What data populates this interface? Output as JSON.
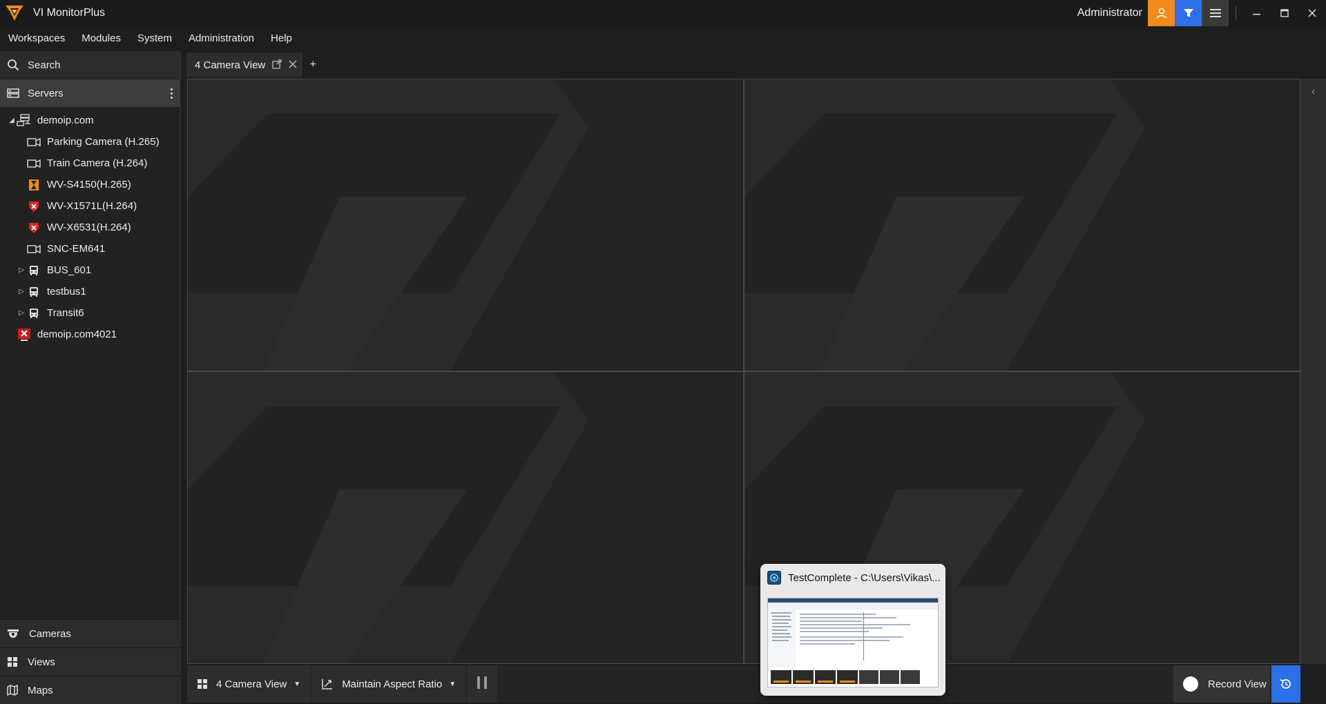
{
  "app": {
    "title": "VI MonitorPlus",
    "user": "Administrator",
    "brand_color": "#f08a1c",
    "accent_color": "#2d6fe6"
  },
  "menu": [
    "Workspaces",
    "Modules",
    "System",
    "Administration",
    "Help"
  ],
  "sidebar": {
    "search_label": "Search",
    "servers_label": "Servers",
    "tree": [
      {
        "label": "demoip.com",
        "icon": "server-icon",
        "expanded": true
      },
      {
        "label": "Parking Camera (H.265)",
        "icon": "camera-icon"
      },
      {
        "label": "Train Camera (H.264)",
        "icon": "camera-icon"
      },
      {
        "label": "WV-S4150(H.265)",
        "icon": "camera-warning-icon"
      },
      {
        "label": "WV-X1571L(H.264)",
        "icon": "camera-error-icon"
      },
      {
        "label": "WV-X6531(H.264)",
        "icon": "camera-error-icon"
      },
      {
        "label": "SNC-EM641",
        "icon": "camera-icon"
      },
      {
        "label": "BUS_601",
        "icon": "bus-icon",
        "collapsed": true
      },
      {
        "label": "testbus1",
        "icon": "bus-icon",
        "collapsed": true
      },
      {
        "label": "Transit6",
        "icon": "bus-icon",
        "collapsed": true
      },
      {
        "label": "demoip.com4021",
        "icon": "server-error-icon"
      }
    ],
    "bottom_nav": [
      "Cameras",
      "Views",
      "Maps"
    ]
  },
  "tabs": [
    {
      "label": "4 Camera View"
    }
  ],
  "toolbar": {
    "layout_label": "4 Camera View",
    "aspect_label": "Maintain Aspect Ratio",
    "record_label": "Record View"
  },
  "thumbnail": {
    "title": "TestComplete - C:\\Users\\Vikas\\..."
  }
}
